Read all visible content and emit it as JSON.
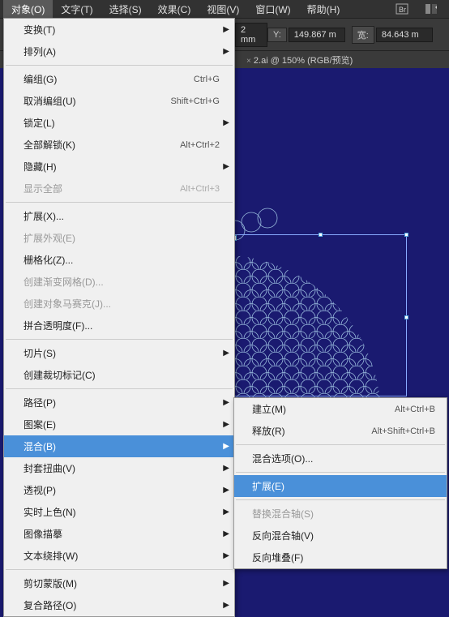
{
  "menubar": {
    "items": [
      "对象(O)",
      "文字(T)",
      "选择(S)",
      "效果(C)",
      "视图(V)",
      "窗口(W)",
      "帮助(H)"
    ]
  },
  "toolbar": {
    "x_suffix": "2 mm",
    "y_label": "Y:",
    "y_value": "149.867 m",
    "w_label": "宽:",
    "w_value": "84.643 m"
  },
  "tab": {
    "name": "2.ai @ 150% (RGB/预览)"
  },
  "menu": {
    "groups": [
      [
        {
          "label": "变换(T)",
          "arrow": true
        },
        {
          "label": "排列(A)",
          "arrow": true
        }
      ],
      [
        {
          "label": "编组(G)",
          "shortcut": "Ctrl+G"
        },
        {
          "label": "取消编组(U)",
          "shortcut": "Shift+Ctrl+G"
        },
        {
          "label": "锁定(L)",
          "arrow": true
        },
        {
          "label": "全部解锁(K)",
          "shortcut": "Alt+Ctrl+2"
        },
        {
          "label": "隐藏(H)",
          "arrow": true
        },
        {
          "label": "显示全部",
          "shortcut": "Alt+Ctrl+3",
          "disabled": true
        }
      ],
      [
        {
          "label": "扩展(X)..."
        },
        {
          "label": "扩展外观(E)",
          "disabled": true
        },
        {
          "label": "栅格化(Z)..."
        },
        {
          "label": "创建渐变网格(D)...",
          "disabled": true
        },
        {
          "label": "创建对象马赛克(J)...",
          "disabled": true
        },
        {
          "label": "拼合透明度(F)..."
        }
      ],
      [
        {
          "label": "切片(S)",
          "arrow": true
        },
        {
          "label": "创建裁切标记(C)"
        }
      ],
      [
        {
          "label": "路径(P)",
          "arrow": true
        },
        {
          "label": "图案(E)",
          "arrow": true
        },
        {
          "label": "混合(B)",
          "arrow": true,
          "highlight": true
        },
        {
          "label": "封套扭曲(V)",
          "arrow": true
        },
        {
          "label": "透视(P)",
          "arrow": true
        },
        {
          "label": "实时上色(N)",
          "arrow": true
        },
        {
          "label": "图像描摹",
          "arrow": true
        },
        {
          "label": "文本绕排(W)",
          "arrow": true
        }
      ],
      [
        {
          "label": "剪切蒙版(M)",
          "arrow": true
        },
        {
          "label": "复合路径(O)",
          "arrow": true
        }
      ]
    ]
  },
  "submenu": {
    "groups": [
      [
        {
          "label": "建立(M)",
          "shortcut": "Alt+Ctrl+B"
        },
        {
          "label": "释放(R)",
          "shortcut": "Alt+Shift+Ctrl+B"
        }
      ],
      [
        {
          "label": "混合选项(O)..."
        }
      ],
      [
        {
          "label": "扩展(E)",
          "highlight": true
        }
      ],
      [
        {
          "label": "替换混合轴(S)",
          "disabled": true
        },
        {
          "label": "反向混合轴(V)"
        },
        {
          "label": "反向堆叠(F)"
        }
      ]
    ]
  }
}
